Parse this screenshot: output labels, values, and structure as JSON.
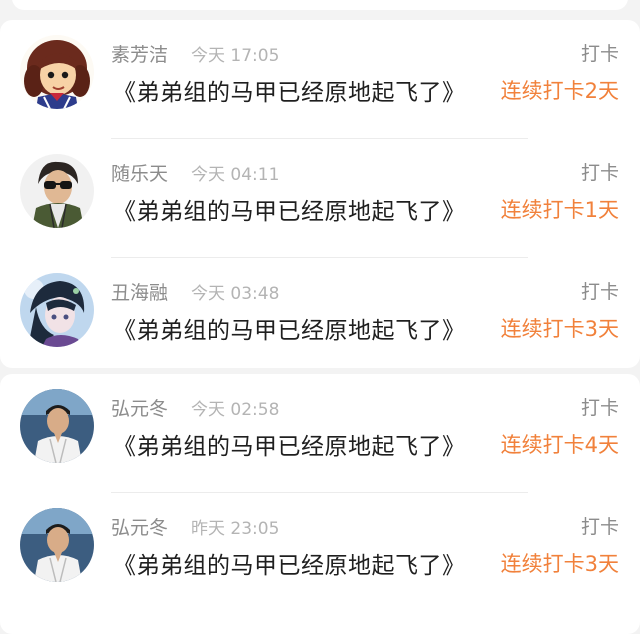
{
  "entries": [
    {
      "username": "素芳洁",
      "time": "今天 17:05",
      "type": "打卡",
      "title": "《弟弟组的马甲已经原地起飞了》",
      "streak": "连续打卡2天"
    },
    {
      "username": "随乐天",
      "time": "今天 04:11",
      "type": "打卡",
      "title": "《弟弟组的马甲已经原地起飞了》",
      "streak": "连续打卡1天"
    },
    {
      "username": "丑海融",
      "time": "今天 03:48",
      "type": "打卡",
      "title": "《弟弟组的马甲已经原地起飞了》",
      "streak": "连续打卡3天"
    },
    {
      "username": "弘元冬",
      "time": "今天 02:58",
      "type": "打卡",
      "title": "《弟弟组的马甲已经原地起飞了》",
      "streak": "连续打卡4天"
    },
    {
      "username": "弘元冬",
      "time": "昨天 23:05",
      "type": "打卡",
      "title": "《弟弟组的马甲已经原地起飞了》",
      "streak": "连续打卡3天"
    }
  ],
  "colors": {
    "accent": "#f1813b",
    "name_text": "#8c8c8c",
    "time_text": "#b4b4b4",
    "title_text": "#1f1f1f",
    "background": "#f3f3f3",
    "card": "#ffffff"
  }
}
